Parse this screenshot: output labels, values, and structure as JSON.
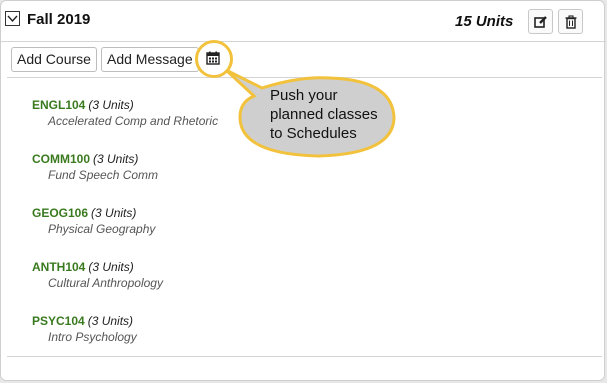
{
  "term": {
    "title": "Fall 2019",
    "units": "15 Units",
    "icons": {
      "toggle": "collapse-toggle-icon",
      "edit": "edit-icon",
      "delete": "trash-icon"
    }
  },
  "toolbar": {
    "add_course": "Add Course",
    "add_message": "Add Message",
    "push_icon": "calendar-icon"
  },
  "courses": [
    {
      "code": "ENGL104",
      "units": "(3 Units)",
      "name": "Accelerated Comp and Rhetoric"
    },
    {
      "code": "COMM100",
      "units": "(3 Units)",
      "name": "Fund Speech Comm"
    },
    {
      "code": "GEOG106",
      "units": "(3 Units)",
      "name": "Physical Geography"
    },
    {
      "code": "ANTH104",
      "units": "(3 Units)",
      "name": "Cultural Anthropology"
    },
    {
      "code": "PSYC104",
      "units": "(3 Units)",
      "name": "Intro Psychology"
    }
  ],
  "callout": {
    "line1": "Push your",
    "line2": "planned classes",
    "line3": "to Schedules"
  },
  "colors": {
    "course_code": "#3a7a1f",
    "highlight": "#f2c23c",
    "callout_fill": "#cfcfcf"
  }
}
